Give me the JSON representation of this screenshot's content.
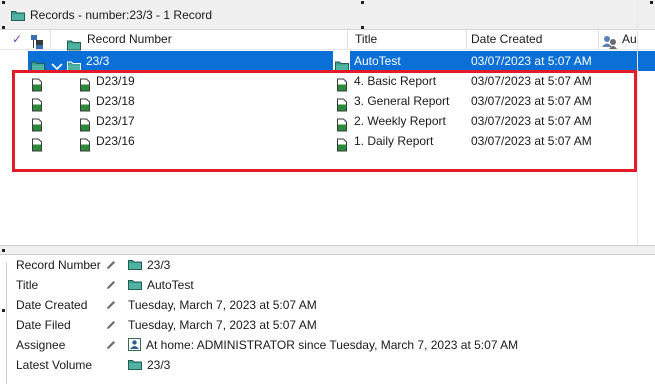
{
  "window": {
    "title": "Records - number:23/3 - 1 Record"
  },
  "header": {
    "record_number": "Record Number",
    "title": "Title",
    "date_created": "Date Created",
    "extra": "Au"
  },
  "rows": [
    {
      "record_number": "23/3",
      "title": "AutoTest",
      "date_created": "03/07/2023 at 5:07 AM"
    },
    {
      "record_number": "D23/19",
      "title": "4. Basic Report",
      "date_created": "03/07/2023 at 5:07 AM"
    },
    {
      "record_number": "D23/18",
      "title": "3. General Report",
      "date_created": "03/07/2023 at 5:07 AM"
    },
    {
      "record_number": "D23/17",
      "title": "2. Weekly Report",
      "date_created": "03/07/2023 at 5:07 AM"
    },
    {
      "record_number": "D23/16",
      "title": "1. Daily Report",
      "date_created": "03/07/2023 at 5:07 AM"
    }
  ],
  "properties": [
    {
      "label": "Record Number",
      "value": "23/3"
    },
    {
      "label": "Title",
      "value": "AutoTest"
    },
    {
      "label": "Date Created",
      "value": "Tuesday, March 7, 2023 at 5:07 AM"
    },
    {
      "label": "Date Filed",
      "value": "Tuesday, March 7, 2023 at 5:07 AM"
    },
    {
      "label": "Assignee",
      "value": "At home: ADMINISTRATOR since Tuesday, March 7, 2023 at 5:07 AM"
    },
    {
      "label": "Latest Volume",
      "value": "23/3"
    }
  ],
  "colors": {
    "selection": "#0a6fd6",
    "highlight_border": "#e21b2a",
    "folder": "#3a9a8a",
    "document": "#2e8b3e"
  }
}
